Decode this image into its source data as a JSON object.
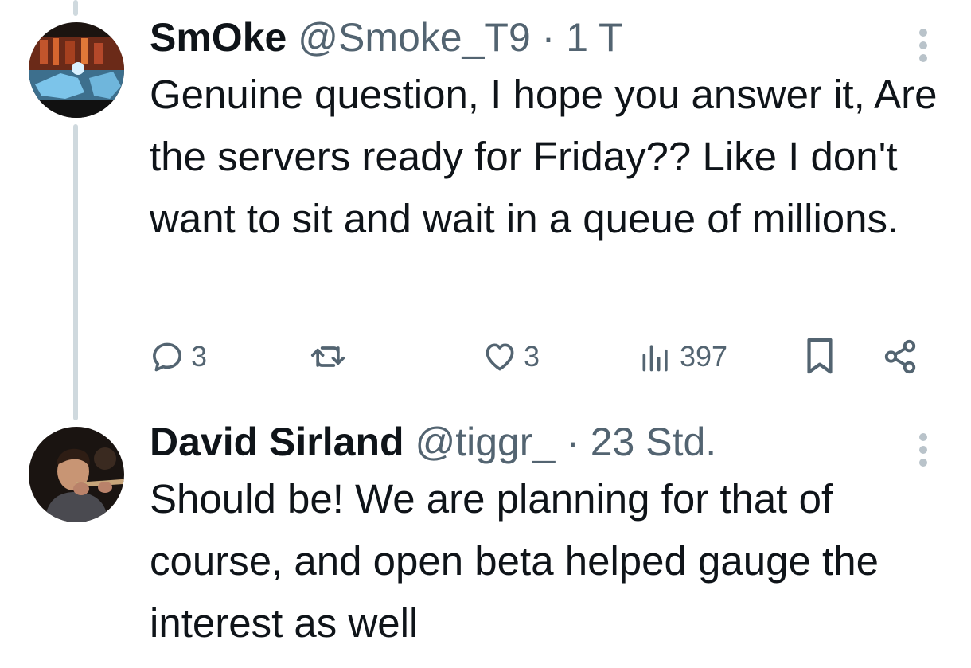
{
  "tweets": [
    {
      "display_name": "SmOke",
      "handle": "@Smoke_T9",
      "separator": "·",
      "time": "1 T",
      "text": "Genuine question, I hope you answer it, Are the servers ready for Friday?? Like I don't want to sit and wait in a queue of millions.",
      "actions": {
        "replies": "3",
        "reposts": "",
        "likes": "3",
        "views": "397"
      }
    },
    {
      "display_name": "David Sirland",
      "handle": "@tiggr_",
      "separator": "·",
      "time": "23 Std.",
      "text": "Should be! We are planning for that of course, and open beta helped gauge the interest as well"
    }
  ],
  "icons": {
    "reply": "reply-icon",
    "repost": "repost-icon",
    "like": "heart-icon",
    "views": "views-icon",
    "bookmark": "bookmark-icon",
    "share": "share-icon",
    "more": "more-icon"
  },
  "colors": {
    "text": "#0f1419",
    "secondary": "#536471",
    "thread_line": "#cfd9de"
  }
}
